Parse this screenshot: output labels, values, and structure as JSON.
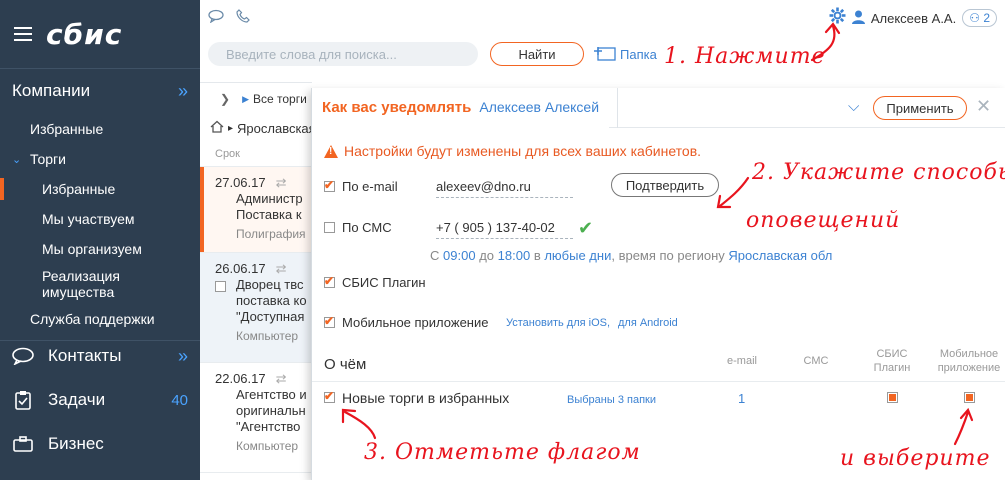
{
  "sidebar": {
    "logo": "сбис",
    "sections": [
      {
        "label": "Компании",
        "chevron": "»"
      },
      {
        "label": "Контакты",
        "chevron": "»"
      },
      {
        "label": "Задачи",
        "count": "40"
      },
      {
        "label": "Бизнес"
      }
    ],
    "items": {
      "favorites": "Избранные",
      "torgi": "Торги",
      "torgi_favorites": "Избранные",
      "participating": "Мы участвуем",
      "organizing": "Мы организуем",
      "property": "Реализация имущества",
      "support": "Служба поддержки"
    }
  },
  "topbar": {
    "user_name": "Алексеев А.А.",
    "badge_count": "2",
    "search_placeholder": "Введите слова для поиска...",
    "find_label": "Найти",
    "folder_label": "Папка"
  },
  "list": {
    "breadcrumb_all": "Все торги",
    "region": "Ярославская",
    "column": "Срок",
    "rows": [
      {
        "date": "27.06.17",
        "line1": "Администр",
        "line2": "Поставка к",
        "meta": "Полиграфия"
      },
      {
        "date": "26.06.17",
        "line1": "Дворец твс",
        "line2": "поставка ко",
        "line3": "\"Доступная",
        "meta": "Компьютер"
      },
      {
        "date": "22.06.17",
        "line1": "Агентство и",
        "line2": "оригинальн",
        "line3": "\"Агентство",
        "meta": "Компьютер"
      }
    ]
  },
  "panel": {
    "title": "Как вас уведомлять",
    "user": "Алексеев Алексей",
    "apply_label": "Применить",
    "warning": "Настройки будут изменены для всех ваших кабинетов.",
    "email_label": "По e-mail",
    "email_value": "alexeev@dno.ru",
    "confirm_label": "Подтвердить",
    "sms_label": "По СМС",
    "phone_value": "+7 ( 905 ) 137-40-02",
    "schedule": {
      "from": "С",
      "t1": "09:00",
      "to": "до",
      "t2": "18:00",
      "in": "в",
      "days": "любые дни",
      "tail": ", время по региону",
      "region": "Ярославская обл"
    },
    "plugin_label": "СБИС Плагин",
    "mobile_label": "Мобильное приложение",
    "ios_link": "Установить для iOS,",
    "android_link": "для Android",
    "about_title": "О чём",
    "col_email": "e-mail",
    "col_sms": "СМС",
    "col_plugin_1": "СБИС",
    "col_plugin_2": "Плагин",
    "col_mobile_1": "Мобильное",
    "col_mobile_2": "приложение",
    "event_label": "Новые торги в избранных",
    "event_folders": "Выбраны 3 папки",
    "event_email_count": "1"
  },
  "annotations": {
    "step1": "1. Нажмите",
    "step2_l1": "2. Укажите способы",
    "step2_l2": "оповещений",
    "step3": "3. Отметьте флагом",
    "step4": "и выберите"
  },
  "colors": {
    "sidebar_bg": "#2d3e50",
    "accent": "#f26522",
    "link": "#3c82d2",
    "annotation": "#e8141e"
  }
}
